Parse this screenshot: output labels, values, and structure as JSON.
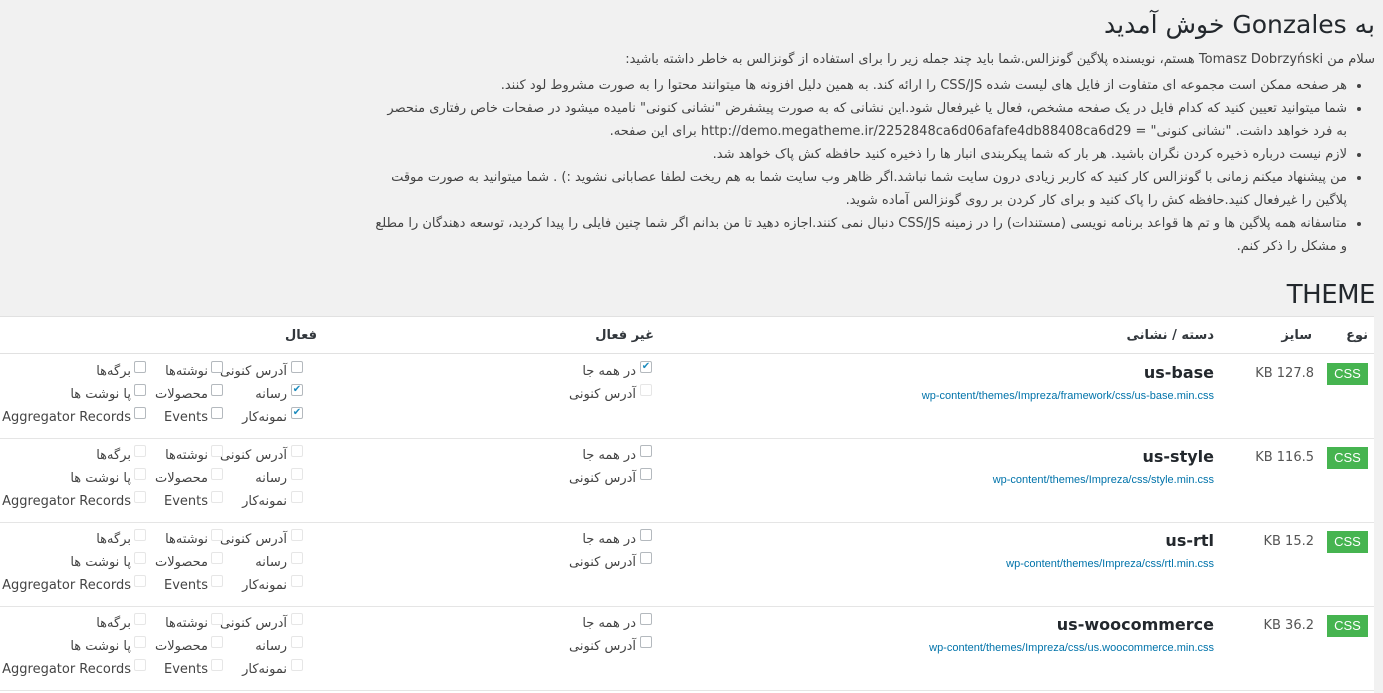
{
  "intro": {
    "title": "به Gonzales خوش آمدید",
    "lead": "سلام من Tomasz Dobrzyński هستم، نویسنده پلاگین گونزالس.شما باید چند جمله زیر را برای استفاده از گونزالس به خاطر داشته باشید:",
    "bullets": [
      "هر صفحه ممکن است مجموعه ای متفاوت از فایل های لیست شده CSS/JS را ارائه کند. به همین دلیل افزونه ها میتوانند محتوا را به صورت مشروط لود کنند.",
      "شما میتوانید تعیین کنید که کدام فایل در یک صفحه مشخص، فعال یا غیرفعال شود.این نشانی که به صورت پیشفرض \"نشانی کنونی\" نامیده میشود در صفحات خاص رفتاری منحصر به فرد خواهد داشت. \"نشانی کنونی\" = http://demo.megatheme.ir/2252848ca6d06afafe4db88408ca6d29 برای این صفحه.",
      "لازم نیست درباره ذخیره کردن نگران باشید. هر بار که شما پیکربندی انبار ها را ذخیره کنید حافظه کش پاک خواهد شد.",
      "من پیشنهاد میکنم زمانی با گونزالس کار کنید که کاربر زیادی درون سایت شما نباشد.اگر ظاهر وب سایت شما به هم ریخت لطفا عصابانی نشوید :) . شما میتوانید به صورت موقت پلاگین را غیرفعال کنید.حافظه کش را پاک کنید و برای کار کردن بر روی گونزالس آماده شوید.",
      "متاسفانه همه پلاگین ها و تم ها قواعد برنامه نویسی (مستندات) را در زمینه CSS/JS دنبال نمی کنند.اجازه دهید تا من بدانم اگر شما چنین فایلی را پیدا کردید، توسعه دهندگان را مطلع و مشکل را ذکر کنم."
    ]
  },
  "section_title": "THEME",
  "table": {
    "headers": {
      "type": "نوع",
      "size": "سایز",
      "handle": "دسته / نشانی",
      "disabled": "غیر فعال",
      "enabled": "فعال"
    },
    "disabled_labels": [
      "در همه جا",
      "آدرس کنونی"
    ],
    "enabled_labels": [
      "آدرس کنونی",
      "نوشته‌ها",
      "برگه‌ها",
      "رسانه",
      "محصولات",
      "پا نوشت ها",
      "نمونه‌کار",
      "Events",
      "Aggregator Records"
    ],
    "rows": [
      {
        "type": "CSS",
        "size": "KB 127.8",
        "name": "us-base",
        "path": "wp-content/themes/Impreza/framework/css/us-base.min.css",
        "disabled_checked": [
          true,
          false
        ],
        "enabled_checked": [
          false,
          false,
          false,
          true,
          false,
          false,
          true,
          false,
          false
        ]
      },
      {
        "type": "CSS",
        "size": "KB 116.5",
        "name": "us-style",
        "path": "wp-content/themes/Impreza/css/style.min.css",
        "disabled_checked": [
          false,
          false
        ],
        "enabled_checked": [
          false,
          false,
          false,
          false,
          false,
          false,
          false,
          false,
          false
        ]
      },
      {
        "type": "CSS",
        "size": "KB 15.2",
        "name": "us-rtl",
        "path": "wp-content/themes/Impreza/css/rtl.min.css",
        "disabled_checked": [
          false,
          false
        ],
        "enabled_checked": [
          false,
          false,
          false,
          false,
          false,
          false,
          false,
          false,
          false
        ]
      },
      {
        "type": "CSS",
        "size": "KB 36.2",
        "name": "us-woocommerce",
        "path": "wp-content/themes/Impreza/css/us.woocommerce.min.css",
        "disabled_checked": [
          false,
          false
        ],
        "enabled_checked": [
          false,
          false,
          false,
          false,
          false,
          false,
          false,
          false,
          false
        ]
      }
    ]
  },
  "colors": {
    "badge": "#46b450",
    "link": "#0073aa",
    "background": "#f1f1f1"
  }
}
